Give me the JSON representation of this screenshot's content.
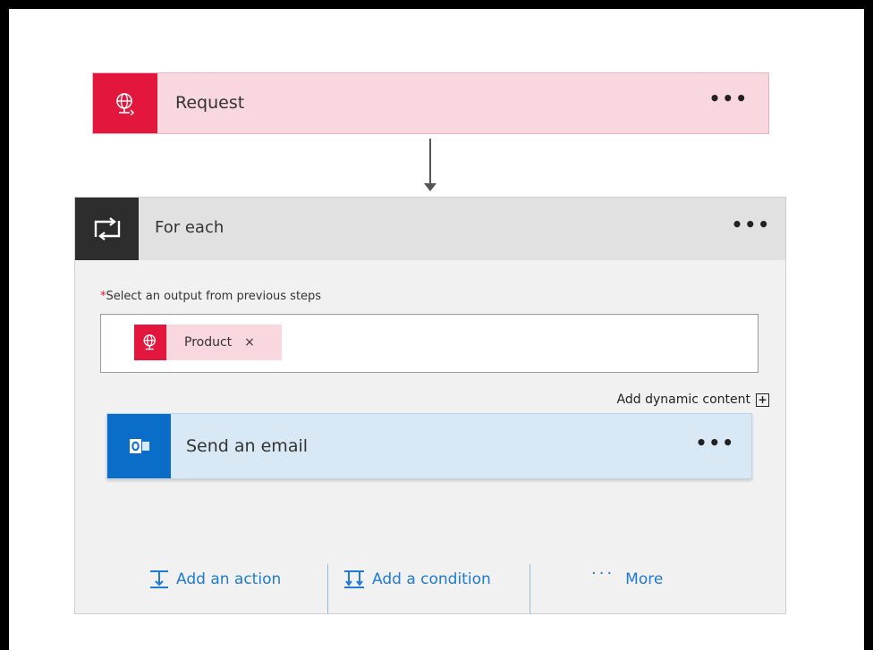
{
  "request": {
    "title": "Request",
    "menu_icon": "ellipsis-icon",
    "icon": "globe-request-icon",
    "accent": "#e3173e"
  },
  "foreach": {
    "title": "For each",
    "icon": "loop-icon",
    "menu_icon": "ellipsis-icon",
    "field_label": "Select an output from previous steps",
    "required_marker": "*",
    "token_label": "Product",
    "token_remove": "×",
    "dynamic_content_label": "Add dynamic content",
    "dynamic_content_icon": "+"
  },
  "email": {
    "title": "Send an email",
    "icon": "outlook-icon",
    "accent": "#0a6ec8"
  },
  "actions": {
    "add_action": "Add an action",
    "add_condition": "Add a condition",
    "more": "More",
    "more_dots": "···",
    "link_color": "#1f7ad6"
  }
}
